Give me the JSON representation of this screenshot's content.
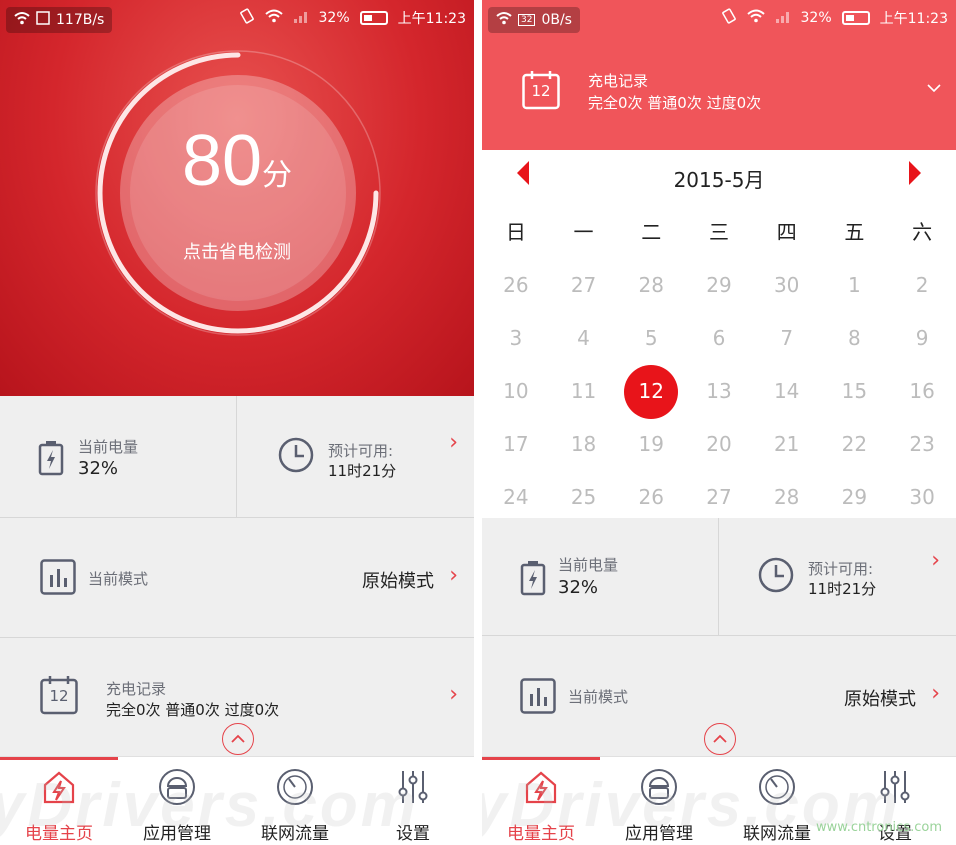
{
  "left": {
    "status": {
      "speed": "117B/s",
      "battery": "32%",
      "time": "上午11:23"
    },
    "score": {
      "value": "80",
      "unit": "分",
      "hint": "点击省电检测"
    },
    "battery_card": {
      "label": "当前电量",
      "value": "32%"
    },
    "estimate_card": {
      "label": "预计可用:",
      "value": "11时21分"
    },
    "mode_card": {
      "label": "当前模式",
      "value": "原始模式"
    },
    "record_card": {
      "label": "充电记录",
      "value": "完全0次 普通0次 过度0次",
      "calendar_day": "12"
    },
    "nav": [
      "电量主页",
      "应用管理",
      "联网流量",
      "设置"
    ],
    "watermark": "yDrivers.com"
  },
  "right": {
    "status": {
      "speed": "0B/s",
      "badge": "32",
      "battery": "32%",
      "time": "上午11:23"
    },
    "record_header": {
      "title": "充电记录",
      "summary": "完全0次 普通0次 过度0次",
      "calendar_day": "12"
    },
    "calendar": {
      "title": "2015-5月",
      "weekdays": [
        "日",
        "一",
        "二",
        "三",
        "四",
        "五",
        "六"
      ],
      "days": [
        [
          "26",
          "27",
          "28",
          "29",
          "30",
          "1",
          "2"
        ],
        [
          "3",
          "4",
          "5",
          "6",
          "7",
          "8",
          "9"
        ],
        [
          "10",
          "11",
          "12",
          "13",
          "14",
          "15",
          "16"
        ],
        [
          "17",
          "18",
          "19",
          "20",
          "21",
          "22",
          "23"
        ],
        [
          "24",
          "25",
          "26",
          "27",
          "28",
          "29",
          "30"
        ]
      ],
      "selected": "12"
    },
    "battery_card": {
      "label": "当前电量",
      "value": "32%"
    },
    "estimate_card": {
      "label": "预计可用:",
      "value": "11时21分"
    },
    "mode_card": {
      "label": "当前模式",
      "value": "原始模式"
    },
    "nav": [
      "电量主页",
      "应用管理",
      "联网流量",
      "设置"
    ],
    "watermark": "yDrivers.com",
    "credit": "www.cntronics.com"
  },
  "colors": {
    "accent": "#e5434a",
    "hero_red": "#d4262c",
    "header_red": "#f0555a",
    "selected_day": "#e8141a"
  }
}
